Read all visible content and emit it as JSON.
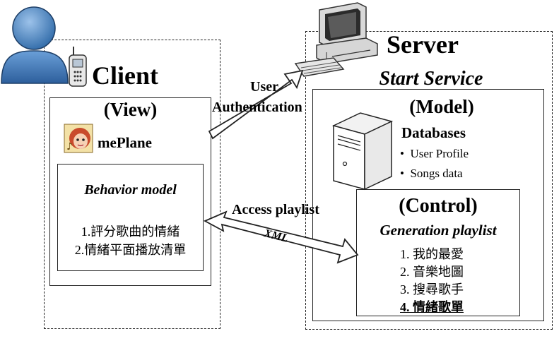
{
  "client": {
    "title": "Client",
    "view_title": "(View)",
    "app_name": "mePlane",
    "behavior_title": "Behavior model",
    "behavior_items": [
      "1.評分歌曲的情緒",
      "2.情緒平面播放清單"
    ]
  },
  "server": {
    "title": "Server",
    "start_service": "Start Service",
    "model_title": "(Model)",
    "databases_label": "Databases",
    "db_items": [
      "User Profile",
      "Songs data"
    ],
    "control_title": "(Control)",
    "generation_title": "Generation playlist",
    "playlist_items": [
      "1. 我的最愛",
      "2. 音樂地圖",
      "3. 搜尋歌手",
      "4. 情緒歌單"
    ]
  },
  "arrows": {
    "auth_line1": "User",
    "auth_line2": "Authentication",
    "access": "Access playlist",
    "xml": "XML"
  },
  "icons": [
    "user-icon",
    "phone-icon",
    "computer-icon",
    "database-server-icon",
    "meplane-icon"
  ]
}
